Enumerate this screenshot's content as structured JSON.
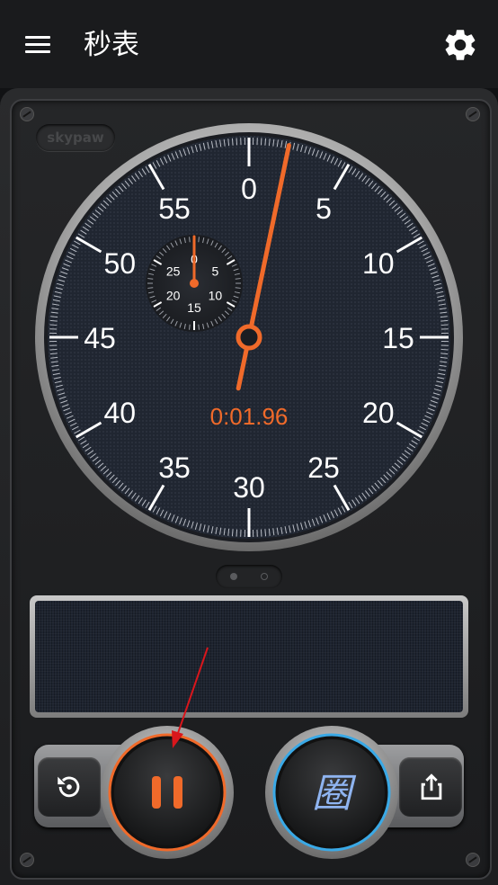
{
  "header": {
    "title": "秒表",
    "menu_icon": "hamburger-menu-icon",
    "settings_icon": "gear-icon"
  },
  "brand": {
    "logo_text": "skypaw"
  },
  "dial": {
    "major_labels": [
      "0",
      "5",
      "10",
      "15",
      "20",
      "25",
      "30",
      "35",
      "40",
      "45",
      "50",
      "55"
    ],
    "sub_dial_labels": [
      "0",
      "5",
      "10",
      "15",
      "20",
      "25"
    ],
    "elapsed_display": "0:01.96",
    "hand_color": "#f06a2a",
    "display_color": "#f06a2a",
    "second_hand_seconds": 1.96,
    "sub_hand_minutes": 0
  },
  "pager": {
    "pages": 2,
    "active_index": 0
  },
  "controls": {
    "reset_icon": "reset-history-icon",
    "pause_icon": "pause-icon",
    "lap_label": "圈",
    "share_icon": "share-icon",
    "pause_accent": "#f06a2a",
    "lap_accent": "#3aa9e6"
  },
  "annotation": {
    "arrow_color": "#d9161c"
  }
}
